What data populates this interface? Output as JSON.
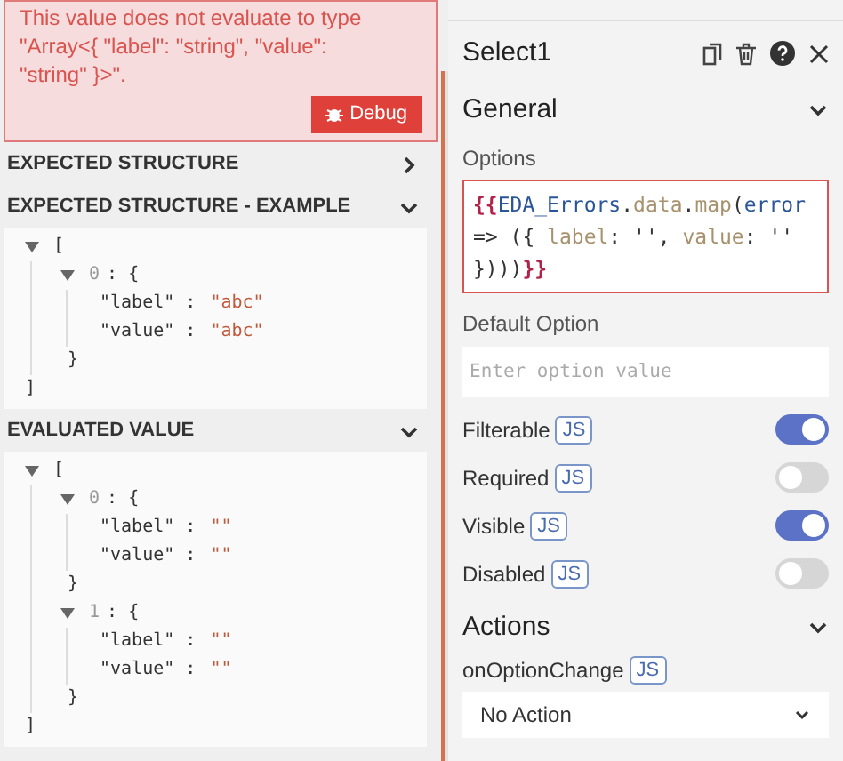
{
  "error": {
    "message": "This value does not evaluate to type \"Array<{ \"label\": \"string\", \"value\": \"string\" }>\".",
    "debug_button": "Debug"
  },
  "sections": [
    {
      "title": "EXPECTED STRUCTURE",
      "expanded": false
    },
    {
      "title": "EXPECTED STRUCTURE - EXAMPLE",
      "expanded": true,
      "tree": {
        "open": "[",
        "expanded": true,
        "close": "]",
        "children": [
          {
            "index": "0",
            "open": ": {",
            "expanded": true,
            "close": "}",
            "children": [
              {
                "key": "\"label\" :",
                "value": "\"abc\""
              },
              {
                "key": "\"value\" :",
                "value": "\"abc\""
              }
            ]
          }
        ]
      }
    },
    {
      "title": "EVALUATED VALUE",
      "expanded": true,
      "tree": {
        "open": "[",
        "expanded": true,
        "close": "]",
        "children": [
          {
            "index": "0",
            "open": ": {",
            "expanded": true,
            "close": "}",
            "children": [
              {
                "key": "\"label\" :",
                "value": "\"\""
              },
              {
                "key": "\"value\" :",
                "value": "\"\""
              }
            ]
          },
          {
            "index": "1",
            "open": ": {",
            "expanded": true,
            "close": "}",
            "children": [
              {
                "key": "\"label\" :",
                "value": "\"\""
              },
              {
                "key": "\"value\" :",
                "value": "\"\""
              }
            ]
          }
        ]
      }
    }
  ],
  "panel": {
    "title": "Select1",
    "general": {
      "title": "General",
      "expanded": true
    },
    "options": {
      "label": "Options",
      "code": [
        {
          "kind": "brace",
          "text": "{{"
        },
        {
          "kind": "ident",
          "text": "EDA_Errors"
        },
        {
          "kind": "punct",
          "text": "."
        },
        {
          "kind": "prop",
          "text": "data"
        },
        {
          "kind": "punct",
          "text": "."
        },
        {
          "kind": "prop",
          "text": "map"
        },
        {
          "kind": "punct",
          "text": "("
        },
        {
          "kind": "ident",
          "text": "error"
        },
        {
          "kind": "punct",
          "text": " => ({ "
        },
        {
          "kind": "prop",
          "text": "label"
        },
        {
          "kind": "punct",
          "text": ": '', "
        },
        {
          "kind": "prop",
          "text": "value"
        },
        {
          "kind": "punct",
          "text": ": '' })))"
        },
        {
          "kind": "brace",
          "text": "}}"
        }
      ]
    },
    "default_option": {
      "label": "Default Option",
      "placeholder": "Enter option value"
    },
    "toggles": [
      {
        "label": "Filterable",
        "badge": "JS",
        "on": true
      },
      {
        "label": "Required",
        "badge": "JS",
        "on": false
      },
      {
        "label": "Visible",
        "badge": "JS",
        "on": true
      },
      {
        "label": "Disabled",
        "badge": "JS",
        "on": false
      }
    ],
    "actions": {
      "title": "Actions",
      "expanded": true
    },
    "on_option_change": {
      "label": "onOptionChange",
      "badge": "JS",
      "value": "No Action"
    }
  }
}
